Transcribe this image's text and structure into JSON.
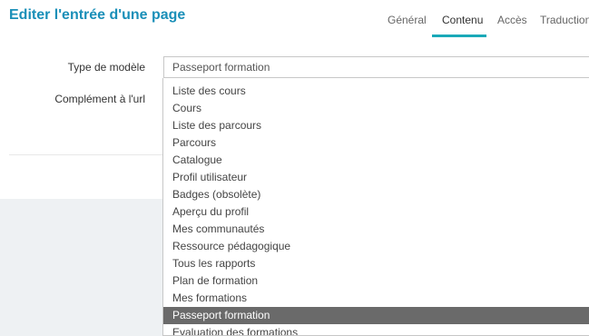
{
  "header": {
    "title": "Editer l'entrée d'une page",
    "tabs": [
      {
        "label": "Général"
      },
      {
        "label": "Contenu"
      },
      {
        "label": "Accès"
      },
      {
        "label": "Traductions"
      }
    ],
    "active_tab": "Contenu",
    "accent_color": "#19a9b8",
    "title_color": "#1a8fb8"
  },
  "form": {
    "type_label": "Type de modèle",
    "complement_label": "Complément à l'url",
    "type_value": "Passeport formation"
  },
  "dropdown": {
    "options": [
      "Liste des cours",
      "Cours",
      "Liste des parcours",
      "Parcours",
      "Catalogue",
      "Profil utilisateur",
      "Badges (obsolète)",
      "Aperçu du profil",
      "Mes communautés",
      "Ressource pédagogique",
      "Tous les rapports",
      "Plan de formation",
      "Mes formations",
      "Passeport formation",
      "Evaluation des formations"
    ],
    "selected": "Passeport formation",
    "selected_color": "#6a6a6a"
  }
}
